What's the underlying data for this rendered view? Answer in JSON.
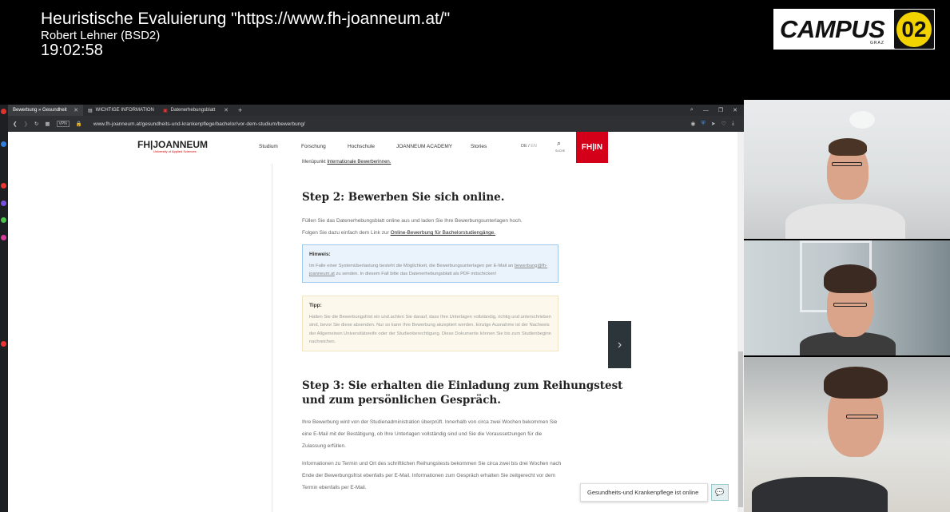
{
  "overlay": {
    "title": "Heuristische Evaluierung \"https://www.fh-joanneum.at/\"",
    "subtitle": "Robert Lehner (BSD2)",
    "time": "19:02:58",
    "logo_text": "CAMPUS",
    "logo_sub": "GRAZ",
    "logo_number": "02"
  },
  "browser": {
    "tabs": [
      {
        "label": "Bewerbung » Gesundheit"
      },
      {
        "label": "WICHTIGE INFORMATION"
      },
      {
        "label": "Datenerhebungsblatt"
      }
    ],
    "new_tab": "+",
    "url": "www.fh-joanneum.at/gesundheits-und-krankenpflege/bachelor/vor-dem-studium/bewerbung/"
  },
  "site": {
    "logo": "FH|JOANNEUM",
    "logo_sub": "University of Applied Sciences",
    "nav": [
      "Studium",
      "Forschung",
      "Hochschule",
      "JOANNEUM ACADEMY",
      "Stories"
    ],
    "lang_de": "DE",
    "lang_sep": "/",
    "lang_en": "EN",
    "search_label": "SUCHE",
    "fhin": "FH|IN"
  },
  "content": {
    "partial_prefix": "Menüpunkt",
    "partial_link": "Internationale Bewerberinnen.",
    "step2_title": "Step 2: Bewerben Sie sich online.",
    "step2_p1": "Füllen Sie das Datenerhebungsblatt online aus und laden Sie Ihre Bewerbungsunterlagen hoch.",
    "step2_p2_prefix": "Folgen Sie dazu einfach dem Link zur",
    "step2_link": "Online-Bewerbung für Bachelorstudiengänge.",
    "hint_title": "Hinweis:",
    "hint_text1": "Im Falle einer Systemüberlastung besteht die Möglichkeit, die Bewerbungsunterlagen per E-Mail an",
    "hint_email": "bewerbung@fh-joanneum.at",
    "hint_text2": "zu senden. In diesem Fall bitte das Datenerhebungsblatt als PDF mitschicken!",
    "tip_title": "Tipp:",
    "tip_text": "Halten Sie die Bewerbungsfrist ein und achten Sie darauf, dass Ihre Unterlagen vollständig, richtig und unterschrieben sind, bevor Sie diese absenden. Nur so kann Ihre Bewerbung akzeptiert werden. Einzige Ausnahme ist der Nachweis der Allgemeinen Universitätsreife oder der Studienberechtigung. Diese Dokumente können Sie bis zum Studienbeginn nachreichen.",
    "step3_title_l1": "Step 3: Sie erhalten die Einladung zum Reihungstest",
    "step3_title_l2": "und zum persönlichen Gespräch.",
    "step3_p1": "Ihre Bewerbung wird von der Studienadministration überprüft. Innerhalb von circa zwei Wochen bekommen Sie eine E-Mail mit der Bestätigung, ob Ihre Unterlagen vollständig sind und Sie die Voraussetzungen für die Zulassung erfüllen.",
    "step3_p2": "Informationen zu Termin und Ort des schriftlichen Reihungstests bekommen Sie circa zwei bis drei Wochen nach Ende der Bewerbungsfrist ebenfalls per E-Mail. Informationen zum Gespräch erhalten Sie zeitgerecht vor dem Termin ebenfalls per E-Mail.",
    "next_arrow": "›",
    "chat_text": "Gesundheits-und Krankenpflege ist online"
  },
  "colors": {
    "brand_red": "#d4001a",
    "hint_border": "#9ec8ec",
    "campus_yellow": "#f2d300"
  }
}
